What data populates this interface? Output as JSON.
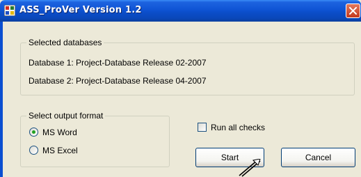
{
  "window": {
    "title": "ASS_ProVer Version 1.2"
  },
  "databases": {
    "legend": "Selected databases",
    "db1": "Database 1: Project-Database Release 02-2007",
    "db2": "Database 2: Project-Database Release 04-2007"
  },
  "output_format": {
    "legend": "Select output format",
    "options": [
      {
        "label": "MS Word",
        "selected": true
      },
      {
        "label": "MS Excel",
        "selected": false
      }
    ]
  },
  "run_all_checks": {
    "label": "Run all checks",
    "checked": false
  },
  "buttons": {
    "start": "Start",
    "cancel": "Cancel"
  }
}
